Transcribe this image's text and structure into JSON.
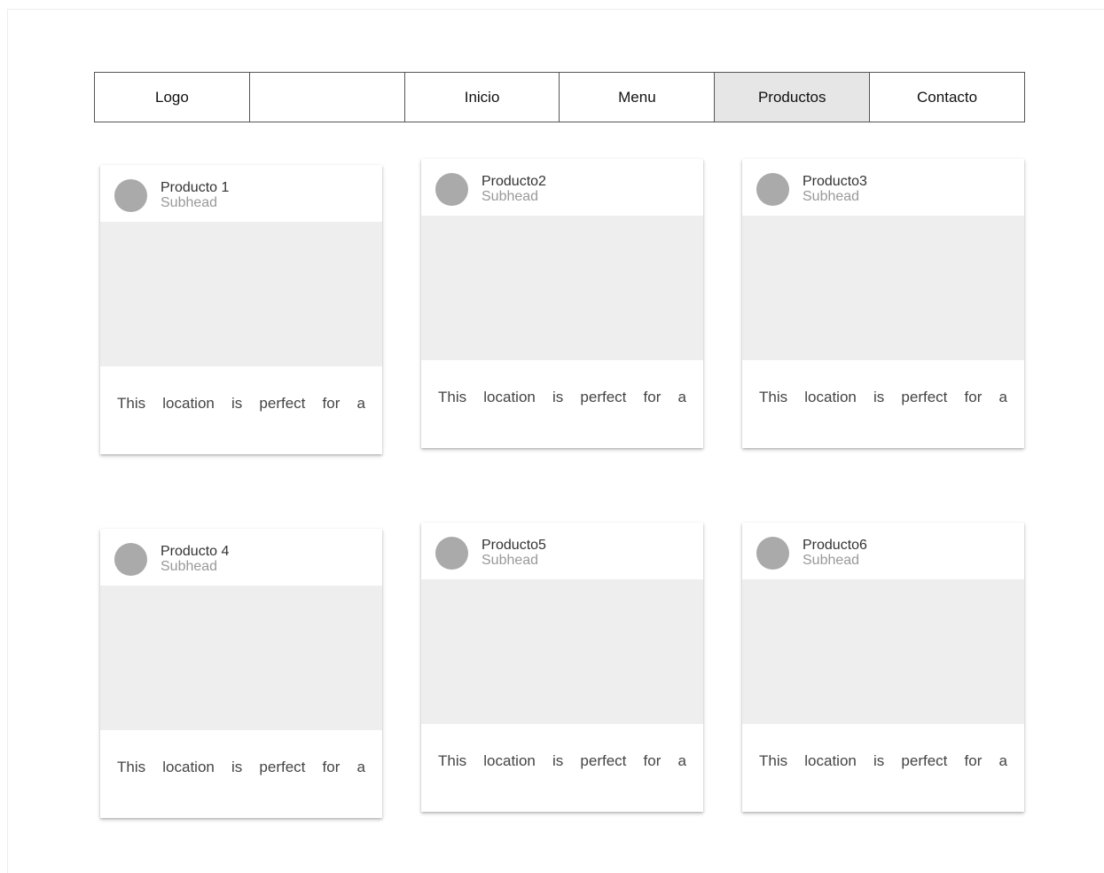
{
  "nav": {
    "items": [
      {
        "label": "Logo",
        "active": false
      },
      {
        "label": "",
        "active": false
      },
      {
        "label": "Inicio",
        "active": false
      },
      {
        "label": "Menu",
        "active": false
      },
      {
        "label": "Productos",
        "active": true
      },
      {
        "label": "Contacto",
        "active": false
      }
    ]
  },
  "cards": [
    {
      "title": "Producto 1",
      "subhead": "Subhead",
      "text": "This location is perfect for a"
    },
    {
      "title": "Producto2",
      "subhead": "Subhead",
      "text": "This location is perfect for a"
    },
    {
      "title": "Producto3",
      "subhead": "Subhead",
      "text": "This location is perfect for a"
    },
    {
      "title": "Producto 4",
      "subhead": "Subhead",
      "text": "This location is perfect for a"
    },
    {
      "title": "Producto5",
      "subhead": "Subhead",
      "text": "This location is perfect for a"
    },
    {
      "title": "Producto6",
      "subhead": "Subhead",
      "text": "This location is perfect for a"
    }
  ],
  "colors": {
    "active_nav_bg": "#e6e6e6",
    "border": "#555555",
    "avatar": "#aaaaaa",
    "media_placeholder": "#eeeeee",
    "subhead_text": "#999999"
  }
}
